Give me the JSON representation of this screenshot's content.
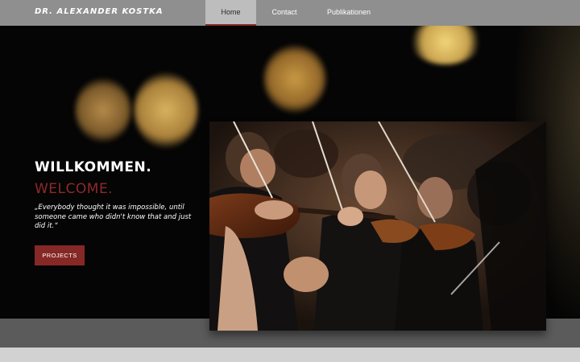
{
  "header": {
    "brand": "DR. ALEXANDER KOSTKA",
    "nav": [
      {
        "label": "Home",
        "active": true
      },
      {
        "label": "Contact",
        "active": false
      },
      {
        "label": "Publikationen",
        "active": false
      }
    ]
  },
  "hero": {
    "title": "WILLKOMMEN.",
    "subtitle": "WELCOME.",
    "quote": "„Everybody thought it was impossible, until someone came who didn't know that and just did it.“",
    "button_label": "PROJECTS",
    "image_subject": "orchestra-violinists-photo"
  },
  "colors": {
    "accent": "#862826",
    "nav_bg": "#8f8f8f",
    "hero_bg": "#050505",
    "band": "#5b5b5b"
  }
}
